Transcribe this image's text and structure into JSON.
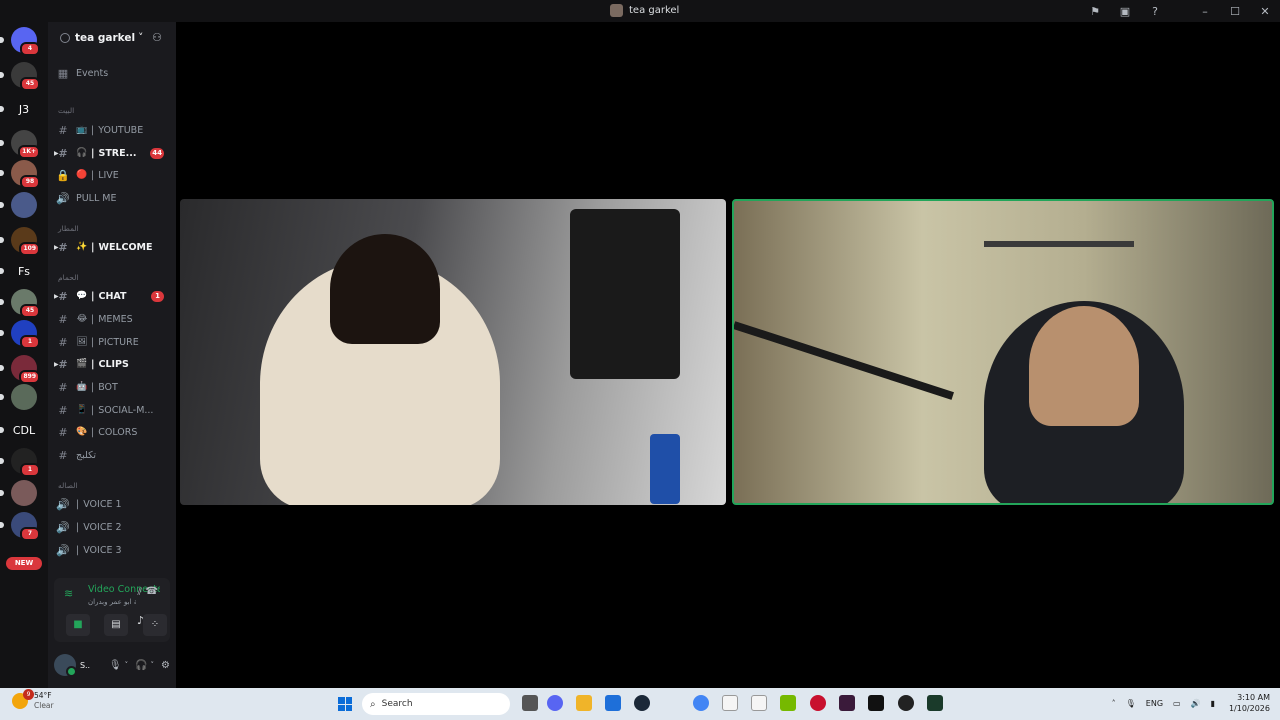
{
  "window": {
    "title": "tea garkel"
  },
  "titlebar_icons": [
    "flag-icon",
    "inbox-icon",
    "help-icon",
    "minimize-icon",
    "maximize-icon",
    "close-icon"
  ],
  "guilds": [
    {
      "label": "",
      "badge": "4",
      "color": "#5865f2",
      "icon": "discord-icon"
    },
    {
      "label": "",
      "badge": "45",
      "color": "#3a3a3a"
    },
    {
      "label": "J3",
      "badge": "",
      "color": "#121214"
    },
    {
      "label": "",
      "badge": "1K+",
      "color": "#444"
    },
    {
      "label": "",
      "badge": "98",
      "color": "#8a5a4a"
    },
    {
      "label": "",
      "badge": "",
      "color": "#4a5a8a"
    },
    {
      "label": "",
      "badge": "109",
      "color": "#5a3a1a"
    },
    {
      "label": "Fs",
      "badge": "",
      "color": "#121214"
    },
    {
      "label": "",
      "badge": "45",
      "color": "#6a7a6a"
    },
    {
      "label": "",
      "badge": "1",
      "color": "#2040c0"
    },
    {
      "label": "",
      "badge": "899",
      "color": "#7a2a3a"
    },
    {
      "label": "",
      "badge": "",
      "color": "#5a6a5a"
    },
    {
      "label": "CDL",
      "badge": "",
      "color": "#121214"
    },
    {
      "label": "",
      "badge": "1",
      "color": "#222"
    },
    {
      "label": "",
      "badge": "",
      "color": "#7a5a5a"
    },
    {
      "label": "",
      "badge": "7",
      "color": "#3a4a7a"
    }
  ],
  "new_pill": "NEW",
  "server": {
    "name": "tea garkel",
    "dropdown": "˅"
  },
  "events_label": "Events",
  "categories": [
    {
      "name": "البيت",
      "channels": [
        {
          "type": "text",
          "emoji": "📺",
          "name": "YOUTUBE",
          "unread": false,
          "count": ""
        },
        {
          "type": "text",
          "emoji": "🎧",
          "name": "STRE...",
          "unread": true,
          "count": "44"
        },
        {
          "type": "lock",
          "emoji": "🔴",
          "name": "LIVE",
          "unread": false,
          "count": ""
        },
        {
          "type": "voice",
          "emoji": "",
          "name": "PULL ME",
          "unread": false,
          "count": ""
        }
      ]
    },
    {
      "name": "المطار",
      "channels": [
        {
          "type": "text",
          "emoji": "✨",
          "name": "WELCOME",
          "unread": true,
          "count": ""
        }
      ]
    },
    {
      "name": "الحمام",
      "channels": [
        {
          "type": "text",
          "emoji": "💬",
          "name": "CHAT",
          "unread": true,
          "count": "1"
        },
        {
          "type": "text",
          "emoji": "😂",
          "name": "MEMES",
          "unread": false,
          "count": ""
        },
        {
          "type": "text",
          "emoji": "🖼",
          "name": "PICTURE",
          "unread": false,
          "count": ""
        },
        {
          "type": "text",
          "emoji": "🎬",
          "name": "CLIPS",
          "unread": true,
          "count": ""
        },
        {
          "type": "text",
          "emoji": "🤖",
          "name": "BOT",
          "unread": false,
          "count": ""
        },
        {
          "type": "text",
          "emoji": "📱",
          "name": "SOCIAL-M...",
          "unread": false,
          "count": ""
        },
        {
          "type": "text",
          "emoji": "🎨",
          "name": "COLORS",
          "unread": false,
          "count": ""
        },
        {
          "type": "text",
          "emoji": "",
          "name": "تكلبج",
          "unread": false,
          "count": ""
        }
      ]
    },
    {
      "name": "الصاله",
      "channels": [
        {
          "type": "voice",
          "emoji": "🔊",
          "name": "VOICE 1",
          "unread": false,
          "count": ""
        },
        {
          "type": "voice",
          "emoji": "🔊",
          "name": "VOICE 2",
          "unread": false,
          "count": ""
        },
        {
          "type": "voice",
          "emoji": "🔊",
          "name": "VOICE 3",
          "unread": false,
          "count": ""
        }
      ]
    }
  ],
  "voice_connection": {
    "status": "Video Connected",
    "subtitle": "عالم / غرفة ابو عمر وبدران"
  },
  "user": {
    "name": "S..",
    "status": "..."
  },
  "taskbar": {
    "weather_temp": "54°F",
    "weather_desc": "Clear",
    "weather_badge": "9",
    "search_placeholder": "Search",
    "lang": "ENG",
    "time": "3:10 AM",
    "date": "1/10/2026"
  }
}
